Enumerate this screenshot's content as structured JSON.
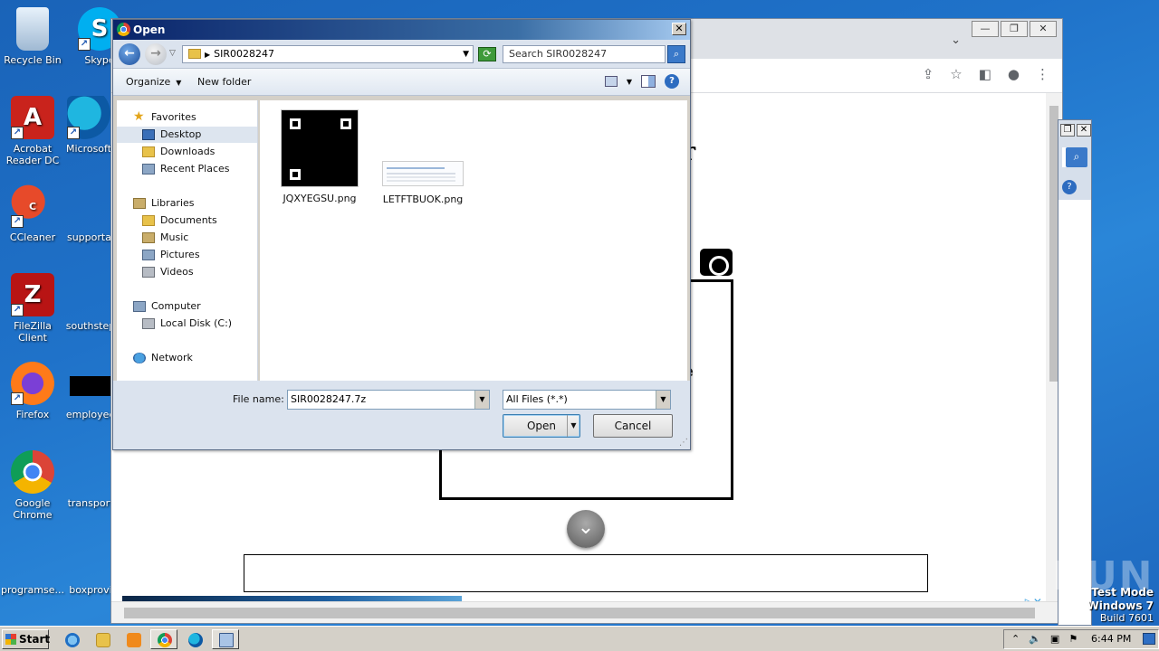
{
  "desktop": {
    "icons": [
      {
        "label": "Recycle Bin"
      },
      {
        "label": "Skype"
      },
      {
        "label": "Acrobat Reader DC"
      },
      {
        "label": "Microsoft"
      },
      {
        "label": "CCleaner"
      },
      {
        "label": "supportal"
      },
      {
        "label": "FileZilla Client"
      },
      {
        "label": "southstep"
      },
      {
        "label": "Firefox"
      },
      {
        "label": "employee"
      },
      {
        "label": "Google Chrome"
      },
      {
        "label": "transport"
      },
      {
        "label": "programse..."
      },
      {
        "label": "boxprovi"
      }
    ]
  },
  "browser": {
    "window_controls": [
      "—",
      "❐",
      "✕"
    ],
    "page_text_r": "r",
    "page_text_f": "f",
    "page_text_e": "e"
  },
  "dialog": {
    "title": "Open",
    "address": "SIR0028247",
    "search_placeholder": "Search SIR0028247",
    "toolbar": {
      "organize": "Organize",
      "new_folder": "New folder"
    },
    "nav": {
      "favorites": "Favorites",
      "desktop": "Desktop",
      "downloads": "Downloads",
      "recent_places": "Recent Places",
      "libraries": "Libraries",
      "documents": "Documents",
      "music": "Music",
      "pictures": "Pictures",
      "videos": "Videos",
      "computer": "Computer",
      "local_disk": "Local Disk (C:)",
      "network": "Network"
    },
    "files": [
      {
        "name": "JQXYEGSU.png"
      },
      {
        "name": "LETFTBUOK.png"
      }
    ],
    "file_name_label": "File name:",
    "file_name_value": "SIR0028247.7z",
    "file_type_value": "All Files (*.*)",
    "open_button": "Open",
    "cancel_button": "Cancel"
  },
  "taskbar": {
    "start_label": "Start",
    "time": "6:44 PM"
  },
  "watermark": "ANY RUN",
  "test_mode": {
    "line1": "Test Mode",
    "line2": "Windows 7",
    "line3": "Build 7601"
  }
}
